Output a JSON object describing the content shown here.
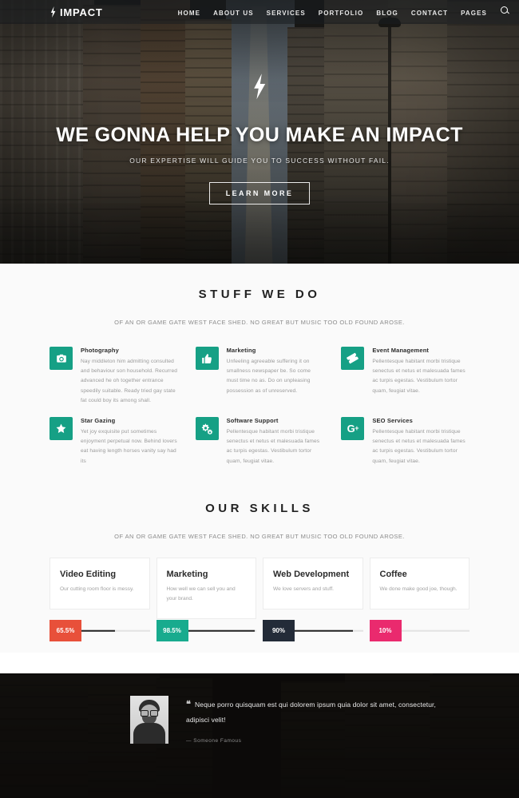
{
  "nav": {
    "brand": "IMPACT",
    "brand_icon": "lightning-bolt-icon",
    "links": [
      "HOME",
      "ABOUT US",
      "SERVICES",
      "PORTFOLIO",
      "BLOG",
      "CONTACT",
      "PAGES"
    ],
    "search_icon": "search-icon"
  },
  "hero": {
    "icon": "lightning-bolt-icon",
    "title": "WE GONNA HELP YOU MAKE AN IMPACT",
    "subtitle": "OUR EXPERTISE WILL GUIDE YOU TO SUCCESS WITHOUT FAIL.",
    "cta": "LEARN MORE"
  },
  "services_section": {
    "title": "STUFF WE DO",
    "subtitle": "OF AN OR GAME GATE WEST FACE SHED. NO GREAT BUT MUSIC TOO OLD FOUND AROSE.",
    "accent_color": "#16a085",
    "items": [
      {
        "icon": "camera-icon",
        "title": "Photography",
        "text": "Nay middleton him admitting consulted and behaviour son household. Recurred advanced he oh together entrance speedily suitable. Ready tried gay state fat could boy its among shall."
      },
      {
        "icon": "thumbs-up-icon",
        "title": "Marketing",
        "text": "Unfeeling agreeable suffering it on smallness newspaper be. So come must time no as. Do on unpleasing possession as of unreserved."
      },
      {
        "icon": "ticket-icon",
        "title": "Event Management",
        "text": "Pellentesque habitant morbi tristique senectus et netus et malesuada fames ac turpis egestas. Vestibulum tortor quam, feugiat vitae."
      },
      {
        "icon": "star-icon",
        "title": "Star Gazing",
        "text": "Yet joy exquisite put sometimes enjoyment perpetual now. Behind lovers eat having length horses vanity say had its"
      },
      {
        "icon": "cogs-icon",
        "title": "Software Support",
        "text": "Pellentesque habitant morbi tristique senectus et netus et malesuada fames ac turpis egestas. Vestibulum tortor quam, feugiat vitae."
      },
      {
        "icon": "google-plus-icon",
        "title": "SEO Services",
        "text": "Pellentesque habitant morbi tristique senectus et netus et malesuada fames ac turpis egestas. Vestibulum tortor quam, feugiat vitae."
      }
    ]
  },
  "skills_section": {
    "title": "OUR SKILLS",
    "subtitle": "OF AN OR GAME GATE WEST FACE SHED. NO GREAT BUT MUSIC TOO OLD FOUND AROSE.",
    "items": [
      {
        "title": "Video Editing",
        "desc": "Our cutting room floor is messy.",
        "value": "65.5%",
        "percent": 65.5,
        "color": "#e8503a"
      },
      {
        "title": "Marketing",
        "desc": "How well we can sell you and your brand.",
        "value": "98.5%",
        "percent": 98.5,
        "color": "#18ab8e"
      },
      {
        "title": "Web Development",
        "desc": "We love servers and stuff.",
        "value": "90%",
        "percent": 90,
        "color": "#232b38"
      },
      {
        "title": "Coffee",
        "desc": "We done make good joe, though.",
        "value": "10%",
        "percent": 10,
        "color": "#ea2a6e"
      }
    ]
  },
  "testimonial": {
    "quote_icon": "quote-left-icon",
    "quote": "Neque porro quisquam est qui dolorem ipsum quia dolor sit amet, consectetur, adipisci velit!",
    "author": "— Someone Famous",
    "avatar": "avatar-photo"
  }
}
